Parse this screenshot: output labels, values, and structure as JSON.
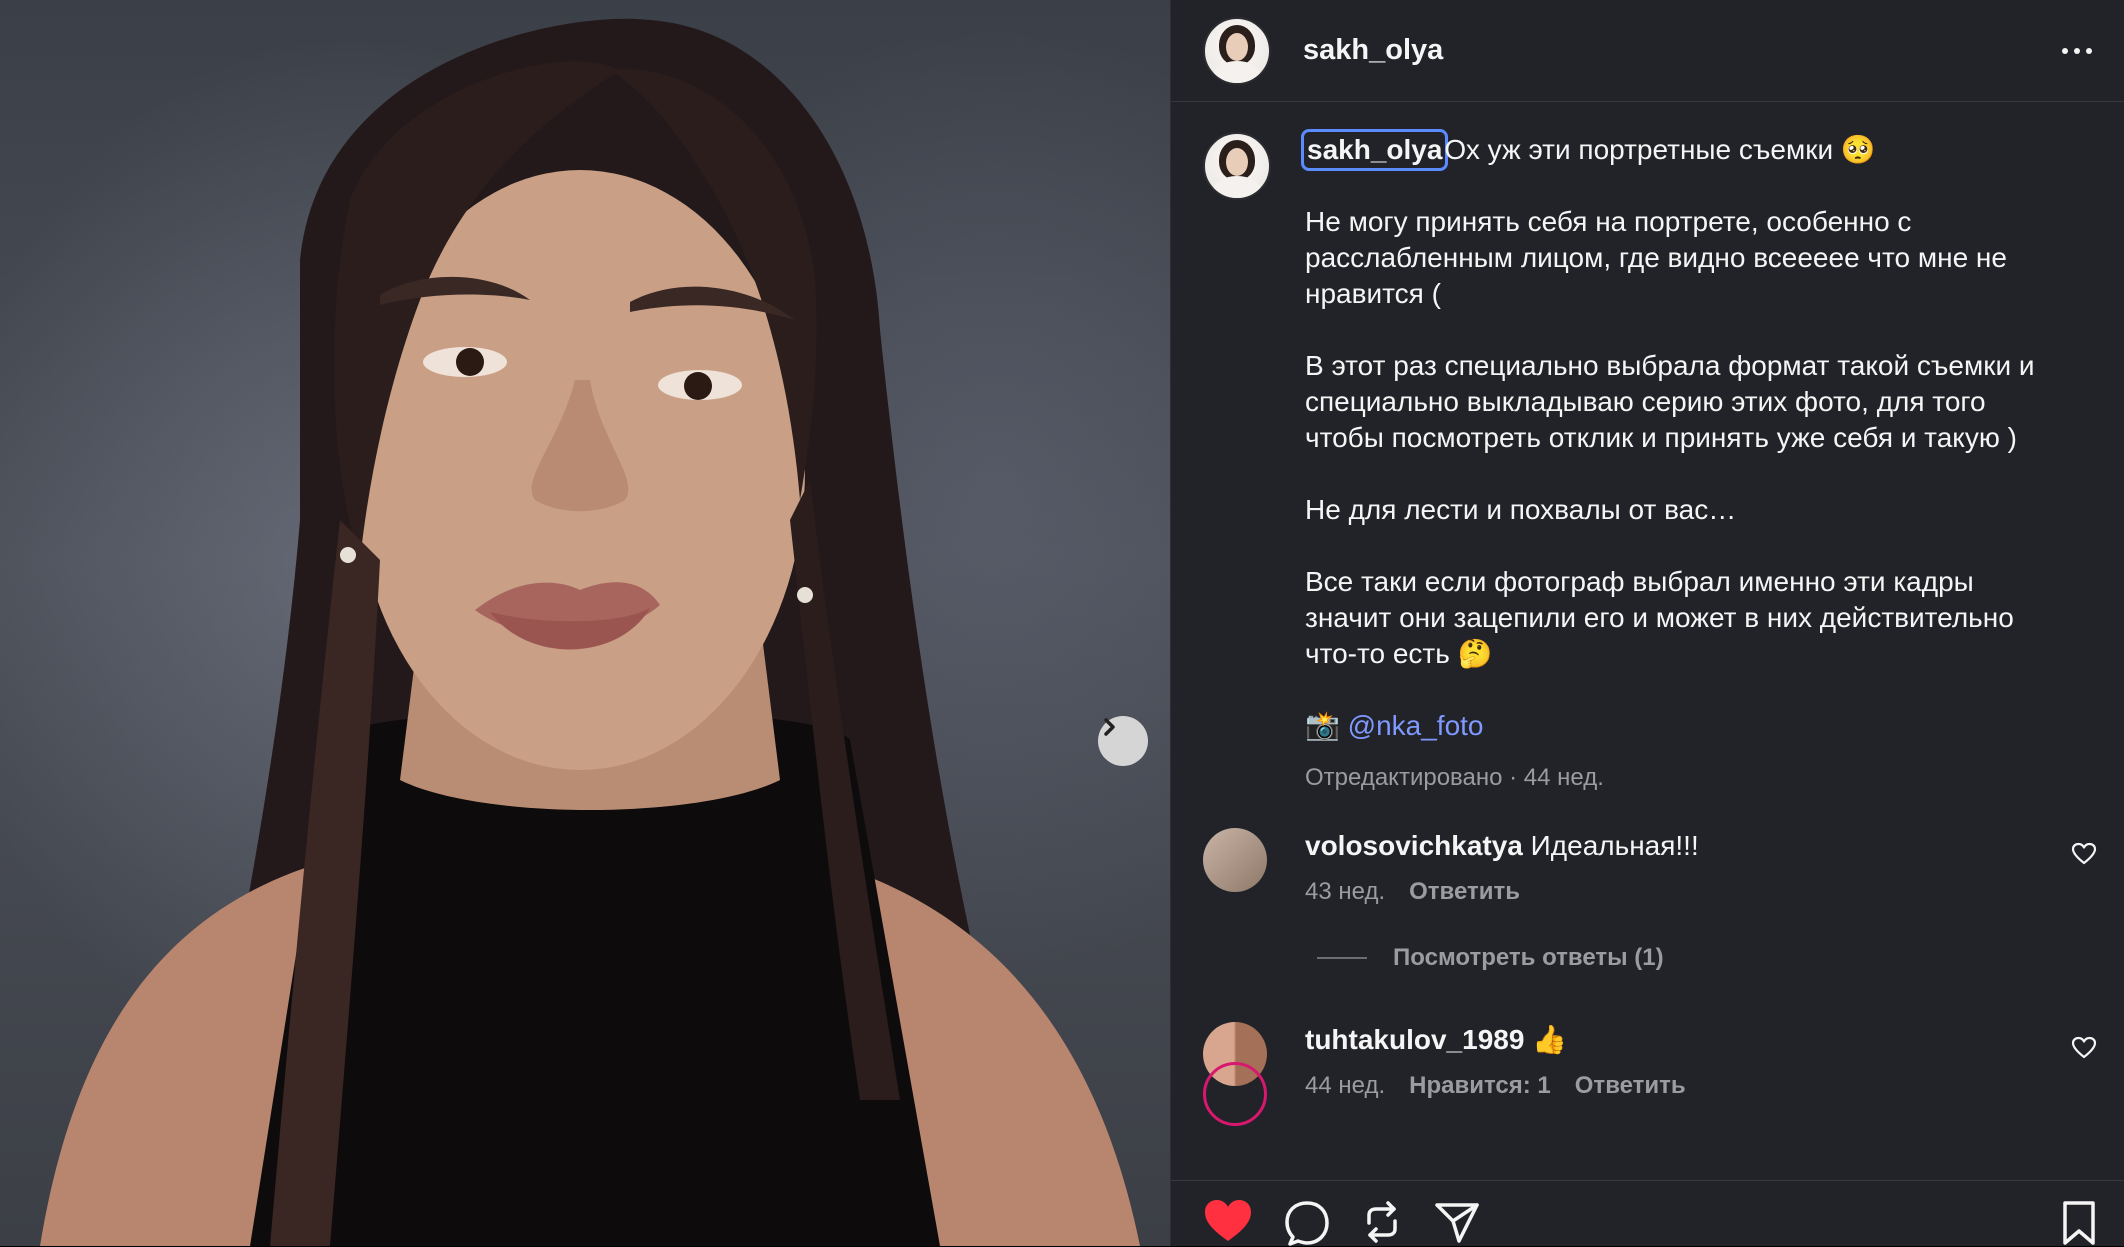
{
  "post": {
    "username": "sakh_olya"
  },
  "caption": {
    "username": "sakh_olya",
    "first_line": "Ох уж эти портретные съемки 🥺",
    "paragraphs": [
      [
        "Не могу принять себя на портрете, особенно с",
        "расслабленным лицом, где видно всеееее что мне не",
        "нравится ("
      ],
      [
        "В этот раз специально выбрала формат такой съемки и",
        "специально выкладываю серию этих фото, для того",
        "чтобы посмотреть отклик и принять уже себя и такую )"
      ],
      [
        "Не для лести и похвалы от вас…"
      ],
      [
        "Все таки если фотограф выбрал именно эти кадры",
        "значит они зацепили его и может в них действительно",
        "что-то есть 🤔"
      ]
    ],
    "credit_emoji": "📸",
    "credit_mention": "@nka_foto",
    "meta": "Отредактировано · 44 нед."
  },
  "comments": [
    {
      "username": "volosovichkatya",
      "text": "Идеальная!!!",
      "time": "43 нед.",
      "reply_label": "Ответить",
      "likes_label": "",
      "view_replies": "Посмотреть ответы (1)"
    },
    {
      "username": "tuhtakulov_1989",
      "text": "👍",
      "time": "44 нед.",
      "likes_label": "Нравится: 1",
      "reply_label": "Ответить"
    }
  ],
  "icons": {
    "like": "heart-filled-icon",
    "comment": "comment-bubble-icon",
    "repost": "repost-icon",
    "share": "paper-plane-icon",
    "save": "bookmark-icon",
    "more": "more-dots-icon",
    "next": "chevron-right-icon"
  },
  "colors": {
    "panel_bg": "#212328",
    "mention": "#7f99ff",
    "like_active": "#ff3040",
    "muted_text": "#9a9ca1"
  }
}
